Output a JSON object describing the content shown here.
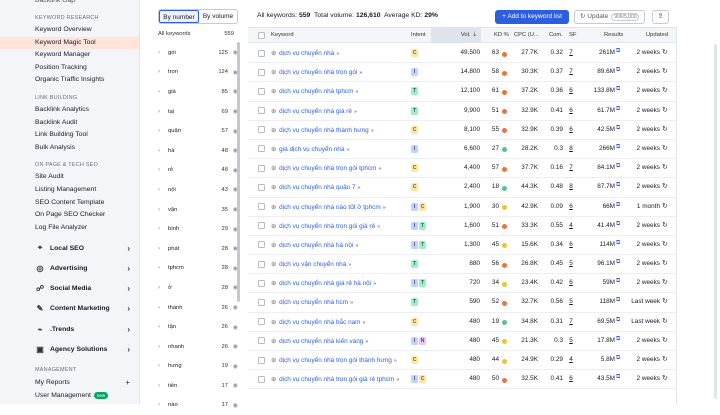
{
  "sidebar": {
    "top_clipped": "Backlink Gap",
    "groups": [
      {
        "heading": "KEYWORD RESEARCH",
        "items": [
          "Keyword Overview",
          "Keyword Magic Tool",
          "Keyword Manager",
          "Position Tracking",
          "Organic Traffic Insights"
        ]
      },
      {
        "heading": "LINK BUILDING",
        "items": [
          "Backlink Analytics",
          "Backlink Audit",
          "Link Building Tool",
          "Bulk Analysis"
        ]
      },
      {
        "heading": "ON PAGE & TECH SEO",
        "items": [
          "Site Audit",
          "Listing Management",
          "SEO Content Template",
          "On Page SEO Checker",
          "Log File Analyzer"
        ]
      }
    ],
    "active_item": "Keyword Magic Tool",
    "sections": [
      {
        "label": "Local SEO",
        "icon": "location-pin-icon"
      },
      {
        "label": "Advertising",
        "icon": "target-icon"
      },
      {
        "label": "Social Media",
        "icon": "social-icon"
      },
      {
        "label": "Content Marketing",
        "icon": "pencil-icon"
      },
      {
        "label": ".Trends",
        "icon": "trends-icon"
      },
      {
        "label": "Agency Solutions",
        "icon": "briefcase-icon"
      }
    ],
    "management_heading": "MANAGEMENT",
    "management_items": [
      {
        "label": "My Reports",
        "action": "+"
      },
      {
        "label": "User Management",
        "badge": "new"
      }
    ]
  },
  "filter_panel": {
    "toggle": {
      "by_number": "By number",
      "by_volume": "By volume",
      "selected": "By number"
    },
    "all_keywords_label": "All keywords",
    "all_keywords_count": "559",
    "groups": [
      {
        "word": "gói",
        "count": "125"
      },
      {
        "word": "trọn",
        "count": "124"
      },
      {
        "word": "giá",
        "count": "85"
      },
      {
        "word": "tại",
        "count": "69"
      },
      {
        "word": "quận",
        "count": "57"
      },
      {
        "word": "hà",
        "count": "48"
      },
      {
        "word": "rẻ",
        "count": "48"
      },
      {
        "word": "nội",
        "count": "43"
      },
      {
        "word": "vận",
        "count": "35"
      },
      {
        "word": "bình",
        "count": "29"
      },
      {
        "word": "phát",
        "count": "28"
      },
      {
        "word": "tphcm",
        "count": "28"
      },
      {
        "word": "ở",
        "count": "28"
      },
      {
        "word": "thành",
        "count": "26"
      },
      {
        "word": "tận",
        "count": "26"
      },
      {
        "word": "nhanh",
        "count": "26"
      },
      {
        "word": "hưng",
        "count": "19"
      },
      {
        "word": "tiền",
        "count": "17"
      },
      {
        "word": "nào",
        "count": "17"
      }
    ]
  },
  "toolbar": {
    "all_keywords_label": "All keywords:",
    "all_keywords_value": "559",
    "total_volume_label": "Total volume:",
    "total_volume_value": "126,610",
    "avg_kd_label": "Average KD:",
    "avg_kd_value": "29%",
    "add_button": "+ Add to keyword list",
    "update_button": "Update",
    "update_count": "906/5,000"
  },
  "table": {
    "headers": {
      "keyword": "Keyword",
      "intent": "Intent",
      "volume": "Vol.",
      "kd": "KD %",
      "cpc": "CPC (U...",
      "com": "Com.",
      "sf": "SF",
      "results": "Results",
      "updated": "Updated"
    },
    "rows": [
      {
        "keyword": "dịch vụ chuyển nhà",
        "intent": [
          "C"
        ],
        "volume": "49,500",
        "kd": "63",
        "kd_color": "#e8743b",
        "cpc": "27.7K",
        "com": "0.32",
        "sf": "7",
        "results": "261M",
        "updated": "2 weeks"
      },
      {
        "keyword": "dịch vụ chuyển nhà trọn gói",
        "intent": [
          "I"
        ],
        "volume": "14,800",
        "kd": "58",
        "kd_color": "#e8743b",
        "cpc": "30.3K",
        "com": "0.37",
        "sf": "7",
        "results": "89.6M",
        "updated": "2 weeks"
      },
      {
        "keyword": "dịch vụ chuyển nhà tphcm",
        "intent": [
          "T"
        ],
        "volume": "12,100",
        "kd": "61",
        "kd_color": "#e8743b",
        "cpc": "37.2K",
        "com": "0.36",
        "sf": "6",
        "results": "133.8M",
        "updated": "2 weeks"
      },
      {
        "keyword": "dịch vụ chuyển nhà giá rẻ",
        "intent": [
          "T"
        ],
        "volume": "9,900",
        "kd": "51",
        "kd_color": "#e8743b",
        "cpc": "32.9K",
        "com": "0.41",
        "sf": "6",
        "results": "61.7M",
        "updated": "2 weeks"
      },
      {
        "keyword": "dịch vụ chuyển nhà thành hưng",
        "intent": [
          "C"
        ],
        "volume": "8,100",
        "kd": "55",
        "kd_color": "#e8743b",
        "cpc": "32.9K",
        "com": "0.39",
        "sf": "6",
        "results": "42.5M",
        "updated": "2 weeks"
      },
      {
        "keyword": "giá dịch vụ chuyển nhà",
        "intent": [
          "I"
        ],
        "volume": "6,600",
        "kd": "27",
        "kd_color": "#59c383",
        "cpc": "28.2K",
        "com": "0.3",
        "sf": "8",
        "results": "266M",
        "updated": "2 weeks"
      },
      {
        "keyword": "dịch vụ chuyển nhà trọn gói tphcm",
        "intent": [
          "C"
        ],
        "volume": "4,400",
        "kd": "57",
        "kd_color": "#e8743b",
        "cpc": "37.7K",
        "com": "0.16",
        "sf": "7",
        "results": "84.1M",
        "updated": "2 weeks"
      },
      {
        "keyword": "dịch vụ chuyển nhà quận 7",
        "intent": [
          "C"
        ],
        "volume": "2,400",
        "kd": "18",
        "kd_color": "#59c383",
        "cpc": "44.3K",
        "com": "0.48",
        "sf": "8",
        "results": "87.7M",
        "updated": "2 weeks"
      },
      {
        "keyword": "dịch vụ chuyển nhà nào tốt ở tphcm",
        "intent": [
          "I",
          "C"
        ],
        "volume": "1,900",
        "kd": "30",
        "kd_color": "#f2c12e",
        "cpc": "42.9K",
        "com": "0.09",
        "sf": "6",
        "results": "66M",
        "updated": "1 month"
      },
      {
        "keyword": "dịch vụ chuyển nhà trọn gói giá rẻ",
        "intent": [
          "I",
          "T"
        ],
        "volume": "1,600",
        "kd": "51",
        "kd_color": "#e8743b",
        "cpc": "33.3K",
        "com": "0.55",
        "sf": "4",
        "results": "41.4M",
        "updated": "2 weeks"
      },
      {
        "keyword": "dịch vụ chuyển nhà hà nội",
        "intent": [
          "I",
          "T"
        ],
        "volume": "1,300",
        "kd": "45",
        "kd_color": "#f2c12e",
        "cpc": "15.6K",
        "com": "0.34",
        "sf": "6",
        "results": "114M",
        "updated": "2 weeks"
      },
      {
        "keyword": "dịch vụ vận chuyển nhà",
        "intent": [
          "T"
        ],
        "volume": "880",
        "kd": "56",
        "kd_color": "#e8743b",
        "cpc": "26.8K",
        "com": "0.45",
        "sf": "5",
        "results": "96.1M",
        "updated": "2 weeks"
      },
      {
        "keyword": "dịch vụ chuyển nhà giá rẻ hà nội",
        "intent": [
          "I",
          "T"
        ],
        "volume": "720",
        "kd": "34",
        "kd_color": "#f2c12e",
        "cpc": "23.4K",
        "com": "0.42",
        "sf": "6",
        "results": "59M",
        "updated": "2 weeks"
      },
      {
        "keyword": "dịch vụ chuyển nhà hcm",
        "intent": [
          "T"
        ],
        "volume": "590",
        "kd": "52",
        "kd_color": "#e8743b",
        "cpc": "32.7K",
        "com": "0.56",
        "sf": "5",
        "results": "118M",
        "updated": "Last week"
      },
      {
        "keyword": "dịch vụ chuyển nhà bắc nam",
        "intent": [
          "C"
        ],
        "volume": "480",
        "kd": "19",
        "kd_color": "#59c383",
        "cpc": "34.8K",
        "com": "0.31",
        "sf": "7",
        "results": "69.5M",
        "updated": "Last week"
      },
      {
        "keyword": "dịch vụ chuyển nhà kiến vàng",
        "intent": [
          "I",
          "N"
        ],
        "volume": "480",
        "kd": "45",
        "kd_color": "#f2c12e",
        "cpc": "21.3K",
        "com": "0.3",
        "sf": "5",
        "results": "17.8M",
        "updated": "2 weeks"
      },
      {
        "keyword": "dịch vụ chuyển nhà trọn gói thành hưng",
        "intent": [
          "C"
        ],
        "volume": "480",
        "kd": "44",
        "kd_color": "#f2c12e",
        "cpc": "24.9K",
        "com": "0.29",
        "sf": "4",
        "results": "5.8M",
        "updated": "2 weeks"
      },
      {
        "keyword": "dịch vụ chuyển nhà trọn gói giá rẻ tphcm",
        "intent": [
          "I",
          "C"
        ],
        "volume": "480",
        "kd": "50",
        "kd_color": "#e8743b",
        "cpc": "32.5K",
        "com": "0.41",
        "sf": "6",
        "results": "43.5M",
        "updated": "2 weeks"
      }
    ]
  }
}
